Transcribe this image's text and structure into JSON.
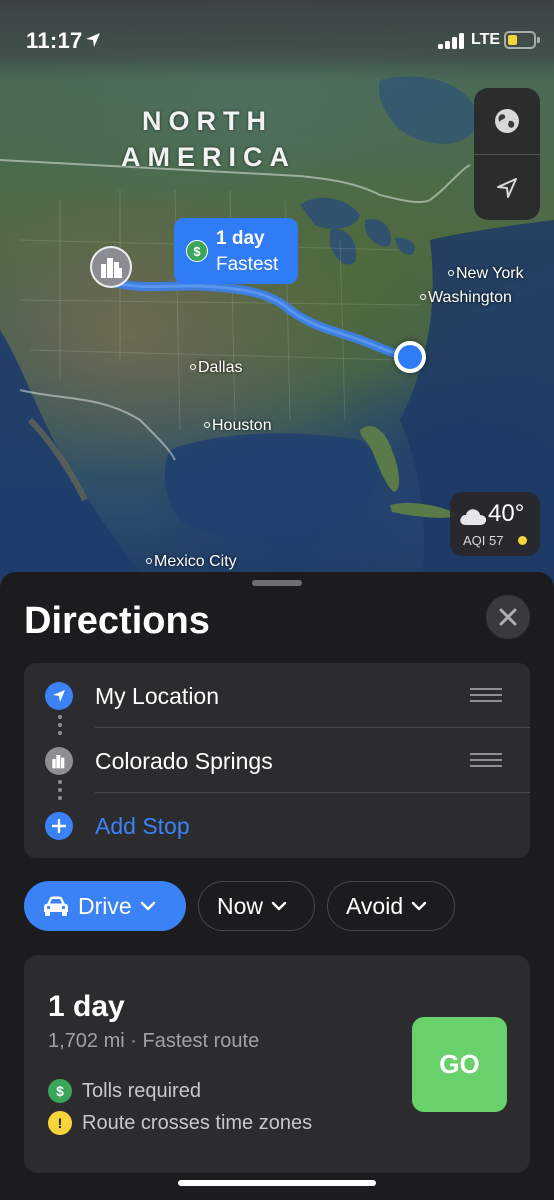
{
  "status_bar": {
    "time": "11:17",
    "network": "LTE"
  },
  "map": {
    "continent_label": "NORTH AMERICA",
    "continent_line1": "NORTH",
    "continent_line2": "AMERICA",
    "cities": [
      "New York",
      "Washington",
      "Dallas",
      "Houston",
      "Mexico City"
    ],
    "route_label": {
      "duration": "1 day",
      "tag": "Fastest",
      "icon": "$"
    },
    "weather": {
      "temperature": "40°",
      "aqi": "AQI 57",
      "aqi_color": "#f7d33c"
    }
  },
  "sheet": {
    "title": "Directions",
    "stops": [
      {
        "label": "My Location",
        "icon": "location-arrow-icon"
      },
      {
        "label": "Colorado Springs",
        "icon": "city-icon"
      }
    ],
    "add_stop": "Add Stop",
    "modes": {
      "drive": "Drive",
      "now": "Now",
      "avoid": "Avoid"
    },
    "route": {
      "duration": "1 day",
      "details": "1,702 mi · Fastest route",
      "notes": [
        {
          "text": "Tolls required",
          "icon": "$",
          "color": "#3aa65a"
        },
        {
          "text": "Route crosses time zones",
          "icon": "!",
          "color": "#f7d33c"
        }
      ],
      "go_label": "GO"
    }
  },
  "colors": {
    "accent": "#3b82f7",
    "go": "#68d16c",
    "sheet_bg": "#1c1c1e",
    "card_bg": "#2c2c2e"
  }
}
